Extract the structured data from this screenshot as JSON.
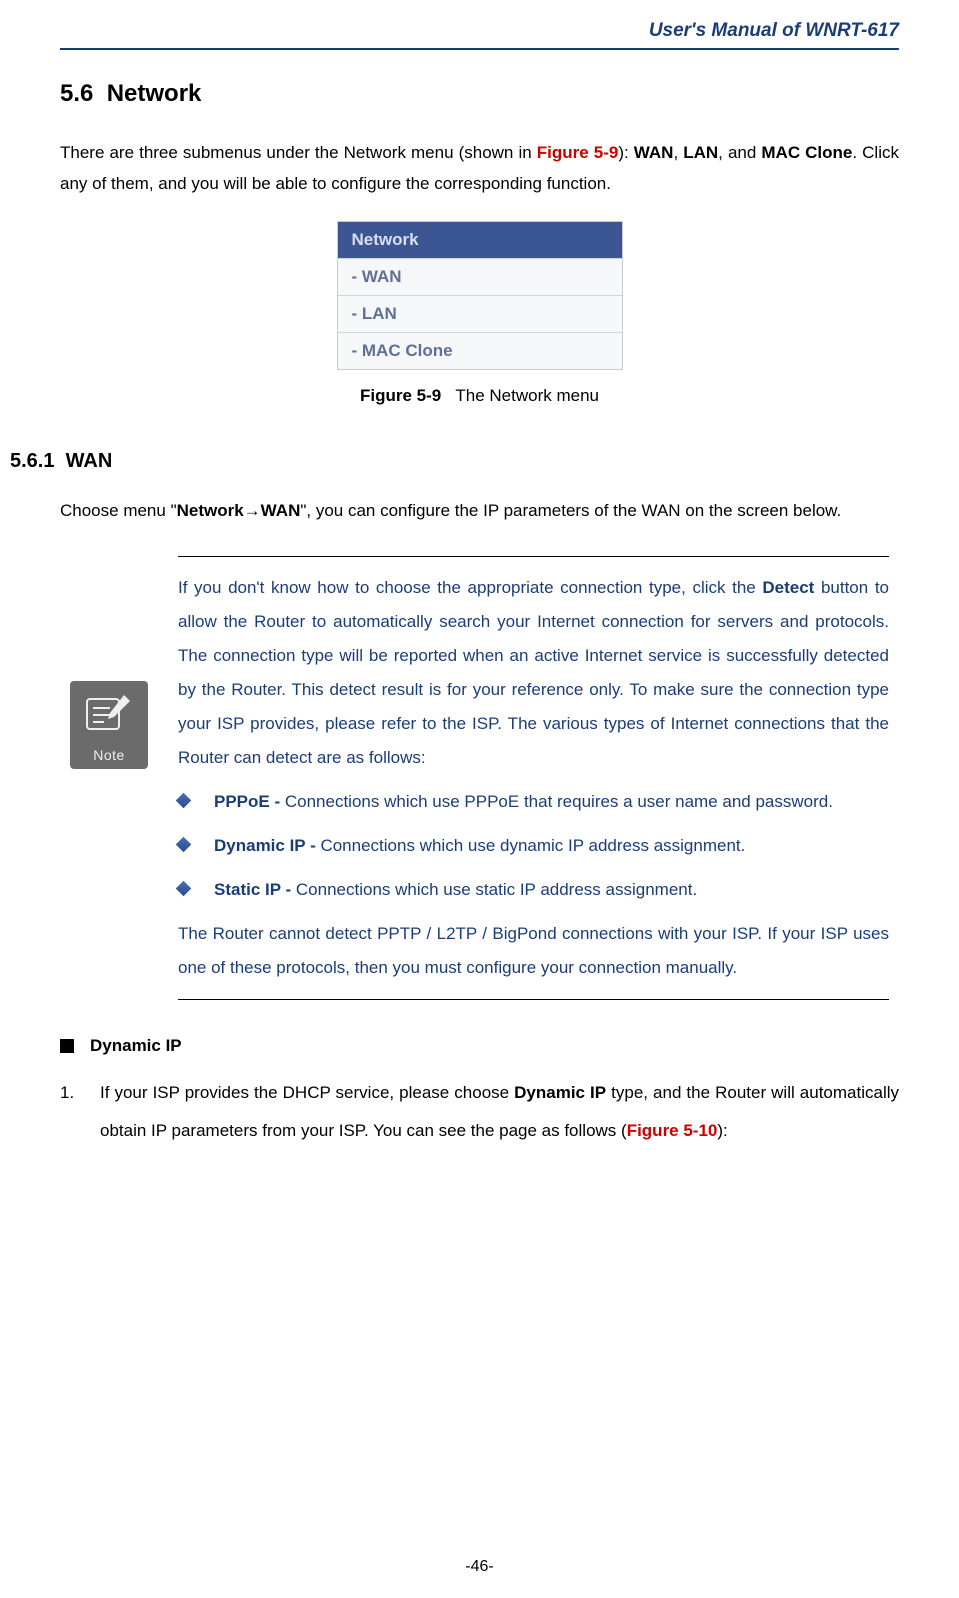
{
  "header": {
    "title": "User's Manual of WNRT-617"
  },
  "section": {
    "number": "5.6",
    "title": "Network"
  },
  "intro": {
    "p1a": "There are three submenus under the Network menu (shown in ",
    "figref": "Figure 5-9",
    "p1b": "): ",
    "b1": "WAN",
    "sep1": ", ",
    "b2": "LAN",
    "sep2": ", and ",
    "b3": "MAC Clone",
    "p1c": ". Click any of them, and you will be able to configure the corresponding function."
  },
  "menu": {
    "head": "Network",
    "items": [
      "- WAN",
      "- LAN",
      "- MAC Clone"
    ]
  },
  "caption": {
    "label": "Figure 5-9",
    "text": "The Network menu"
  },
  "subsection": {
    "number": "5.6.1",
    "title": "WAN",
    "intro_a": "Choose menu \"",
    "intro_b": "Network→WAN",
    "intro_c": "\", you can configure the IP parameters of the WAN on the screen below."
  },
  "note": {
    "icon_label": "Note",
    "p1a": "If you don't know how to choose the appropriate connection type, click the ",
    "p1bold": "Detect",
    "p1b": " button to allow the Router to automatically search your Internet connection for servers and protocols. The connection type will be reported when an active Internet service is successfully detected by the Router. This detect result is for your reference only. To make sure the connection type your ISP provides, please refer to the ISP. The various types of Internet connections that the Router can detect are as follows:",
    "bullets": [
      {
        "title": "PPPoE - ",
        "body": "Connections which use PPPoE that requires a user name and password."
      },
      {
        "title": "Dynamic IP - ",
        "body": "Connections which use dynamic IP address assignment."
      },
      {
        "title": "Static IP - ",
        "body": "Connections which use static IP address assignment."
      }
    ],
    "p2": "The Router cannot detect PPTP / L2TP / BigPond connections with your ISP. If your ISP uses one of these protocols, then you must configure your connection manually."
  },
  "dynamicip": {
    "heading": "Dynamic IP",
    "item1a": "If your ISP provides the DHCP service, please choose ",
    "item1bold": "Dynamic IP",
    "item1b": " type, and the Router will automatically obtain IP parameters from your ISP. You can see the page as follows (",
    "item1ref": "Figure 5-10",
    "item1c": "):"
  },
  "footer": {
    "page": "-46-"
  }
}
